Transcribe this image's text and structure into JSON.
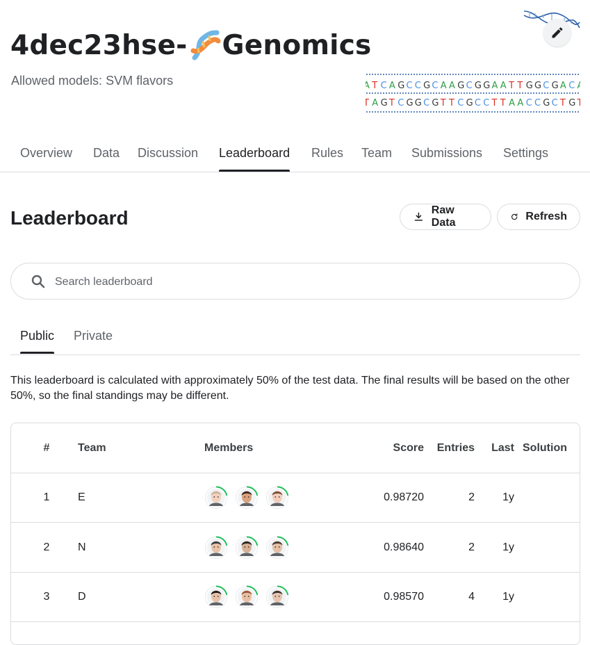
{
  "header": {
    "title_prefix": "4dec23hse-",
    "title_suffix": "Genomics",
    "subtitle": "Allowed models: SVM flavors",
    "banner": {
      "top_strand": "ATCAGCCGCAAGCGGAATTGGCGACA",
      "bottom_strand": "TAGTCGGCGTTCGCCTTAACCGCTGT"
    }
  },
  "nav": {
    "tabs": [
      {
        "label": "Overview"
      },
      {
        "label": "Data"
      },
      {
        "label": "Discussion"
      },
      {
        "label": "Leaderboard",
        "active": true
      },
      {
        "label": "Rules"
      },
      {
        "label": "Team"
      },
      {
        "label": "Submissions"
      },
      {
        "label": "Settings"
      }
    ]
  },
  "section": {
    "title": "Leaderboard",
    "raw_data_label": "Raw Data",
    "refresh_label": "Refresh"
  },
  "search": {
    "placeholder": "Search leaderboard",
    "value": ""
  },
  "subtabs": [
    {
      "label": "Public",
      "active": true
    },
    {
      "label": "Private"
    }
  ],
  "notice": "This leaderboard is calculated with approximately 50% of the test data. The final results will be based on the other 50%, so the final standings may be different.",
  "table": {
    "columns": {
      "rank": "#",
      "team": "Team",
      "members": "Members",
      "score": "Score",
      "entries": "Entries",
      "last": "Last",
      "solution": "Solution"
    },
    "rows": [
      {
        "rank": "1",
        "team": "E",
        "score": "0.98720",
        "entries": "2",
        "last": "1y",
        "members": [
          {
            "skin": "#f1d2c0",
            "hair": "#c9b49a"
          },
          {
            "skin": "#d9a27e",
            "hair": "#3b2a20"
          },
          {
            "skin": "#f3cdbd",
            "hair": "#7a4a32"
          }
        ]
      },
      {
        "rank": "2",
        "team": "N",
        "score": "0.98640",
        "entries": "2",
        "last": "1y",
        "members": [
          {
            "skin": "#e9c3a8",
            "hair": "#3a3a44"
          },
          {
            "skin": "#d6b097",
            "hair": "#2d2522"
          },
          {
            "skin": "#e3c0a7",
            "hair": "#4a3a30"
          }
        ]
      },
      {
        "rank": "3",
        "team": "D",
        "score": "0.98570",
        "entries": "4",
        "last": "1y",
        "members": [
          {
            "skin": "#e7c2ab",
            "hair": "#1e1a1a"
          },
          {
            "skin": "#e9bfa4",
            "hair": "#9a5a3a"
          },
          {
            "skin": "#e6c5b0",
            "hair": "#3a3030"
          }
        ]
      }
    ]
  },
  "colors": {
    "ring": "#20be5a",
    "dna_red": "#d93025",
    "dna_blue": "#4a90e2",
    "dna_green": "#2e9e45",
    "dna_dark": "#3a3a3a",
    "emoji_helix_a": "#f28b3c",
    "emoji_helix_b": "#6fb7e6"
  },
  "icons": {
    "edit": "pencil-icon",
    "download": "download-icon",
    "refresh": "refresh-icon",
    "search": "search-icon",
    "title_emoji": "dna-icon"
  }
}
